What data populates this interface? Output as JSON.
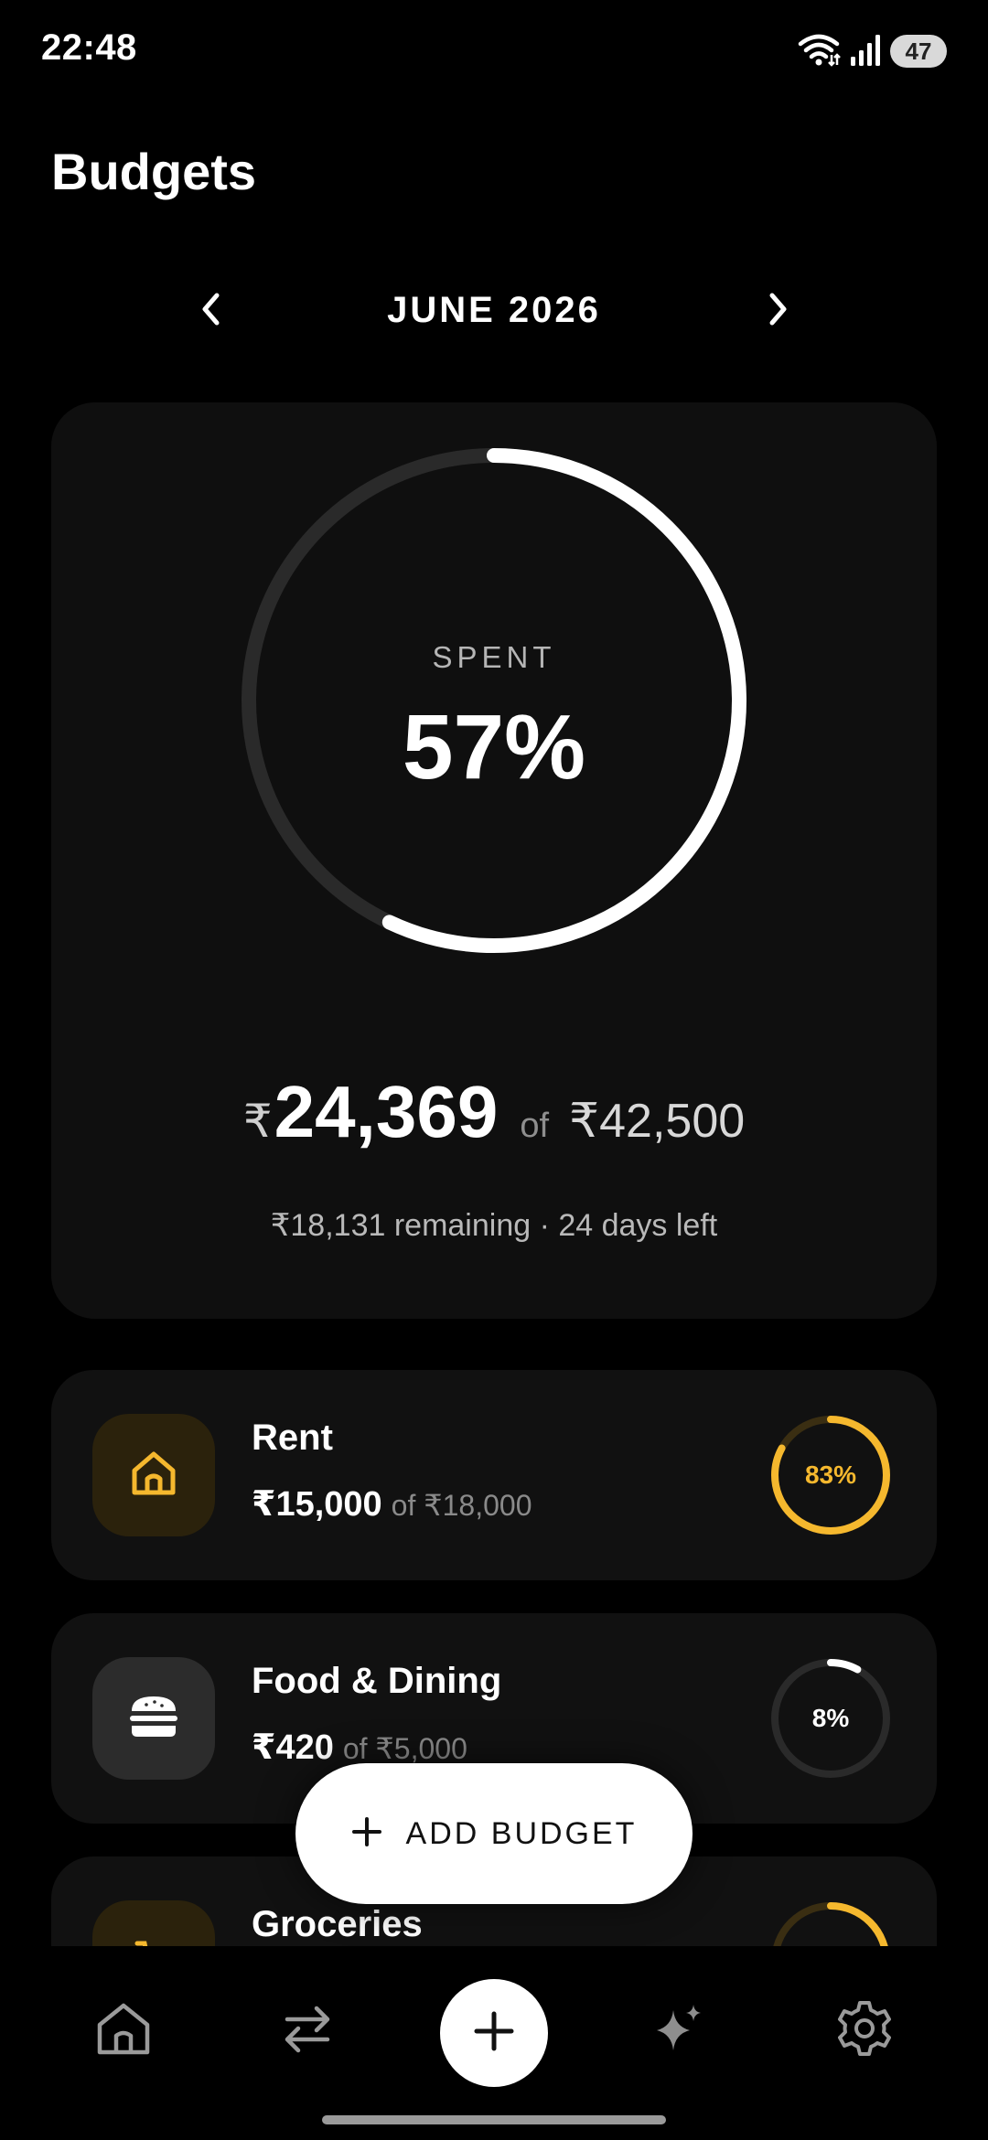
{
  "status_bar": {
    "time": "22:48",
    "battery": "47",
    "icons": [
      "wifi-icon",
      "signal-icon",
      "battery-icon"
    ]
  },
  "header": {
    "title": "Budgets"
  },
  "month_nav": {
    "label": "JUNE 2026",
    "prev_icon": "chevron-left-icon",
    "next_icon": "chevron-right-icon"
  },
  "summary": {
    "ring_label": "SPENT",
    "percent_text": "57%",
    "percent_value": 0.57,
    "currency": "₹",
    "spent": "24,369",
    "of_word": "of",
    "total": "₹42,500",
    "remaining_line": "₹18,131 remaining · 24 days left"
  },
  "budgets": [
    {
      "name": "Rent",
      "spent": "₹15,000",
      "of_total": "of ₹18,000",
      "percent_text": "83%",
      "percent_value": 0.83,
      "icon": "house-icon",
      "accent": "#f5b82e"
    },
    {
      "name": "Food & Dining",
      "spent": "₹420",
      "of_total": "of ₹5,000",
      "percent_text": "8%",
      "percent_value": 0.08,
      "icon": "burger-icon",
      "accent": "#ffffff"
    },
    {
      "name": "Groceries",
      "icon": "groceries-icon",
      "accent": "#f5b82e"
    }
  ],
  "fab": {
    "label": "ADD BUDGET",
    "icon": "plus-icon"
  },
  "tabbar": {
    "items": [
      "home-icon",
      "transfer-icon",
      "plus-icon",
      "sparkle-icon",
      "gear-icon"
    ]
  },
  "colors": {
    "background": "#000000",
    "card": "#111111",
    "accent_yellow": "#f5b82e",
    "ring_track": "#2a2a2a"
  }
}
